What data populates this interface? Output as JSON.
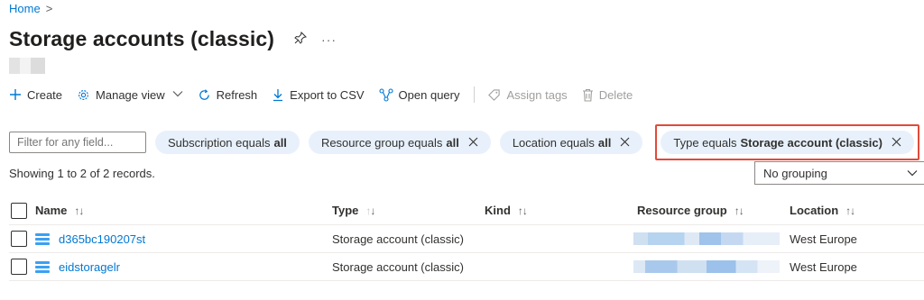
{
  "breadcrumb": {
    "home": "Home",
    "separator": ">"
  },
  "page": {
    "title": "Storage accounts (classic)",
    "more": "···"
  },
  "toolbar": {
    "create": "Create",
    "manage_view": "Manage view",
    "refresh": "Refresh",
    "export_csv": "Export to CSV",
    "open_query": "Open query",
    "assign_tags": "Assign tags",
    "delete": "Delete"
  },
  "filter": {
    "placeholder": "Filter for any field...",
    "pills": [
      {
        "label": "Subscription equals",
        "value": "all"
      },
      {
        "label": "Resource group equals",
        "value": "all"
      },
      {
        "label": "Location equals",
        "value": "all"
      },
      {
        "label": "Type equals",
        "value": "Storage account (classic)"
      }
    ]
  },
  "records_text": "Showing 1 to 2 of 2 records.",
  "grouping": {
    "selected": "No grouping"
  },
  "table": {
    "columns": {
      "name": "Name",
      "type": "Type",
      "kind": "Kind",
      "resource_group": "Resource group",
      "location": "Location"
    },
    "rows": [
      {
        "name": "d365bc190207st",
        "type": "Storage account (classic)",
        "kind": "",
        "location": "West Europe"
      },
      {
        "name": "eidstoragelr",
        "type": "Storage account (classic)",
        "kind": "",
        "location": "West Europe"
      }
    ]
  },
  "colors": {
    "accent": "#0078d4",
    "pill_bg": "#e8f1fb",
    "highlight_border": "#e04b3a"
  }
}
